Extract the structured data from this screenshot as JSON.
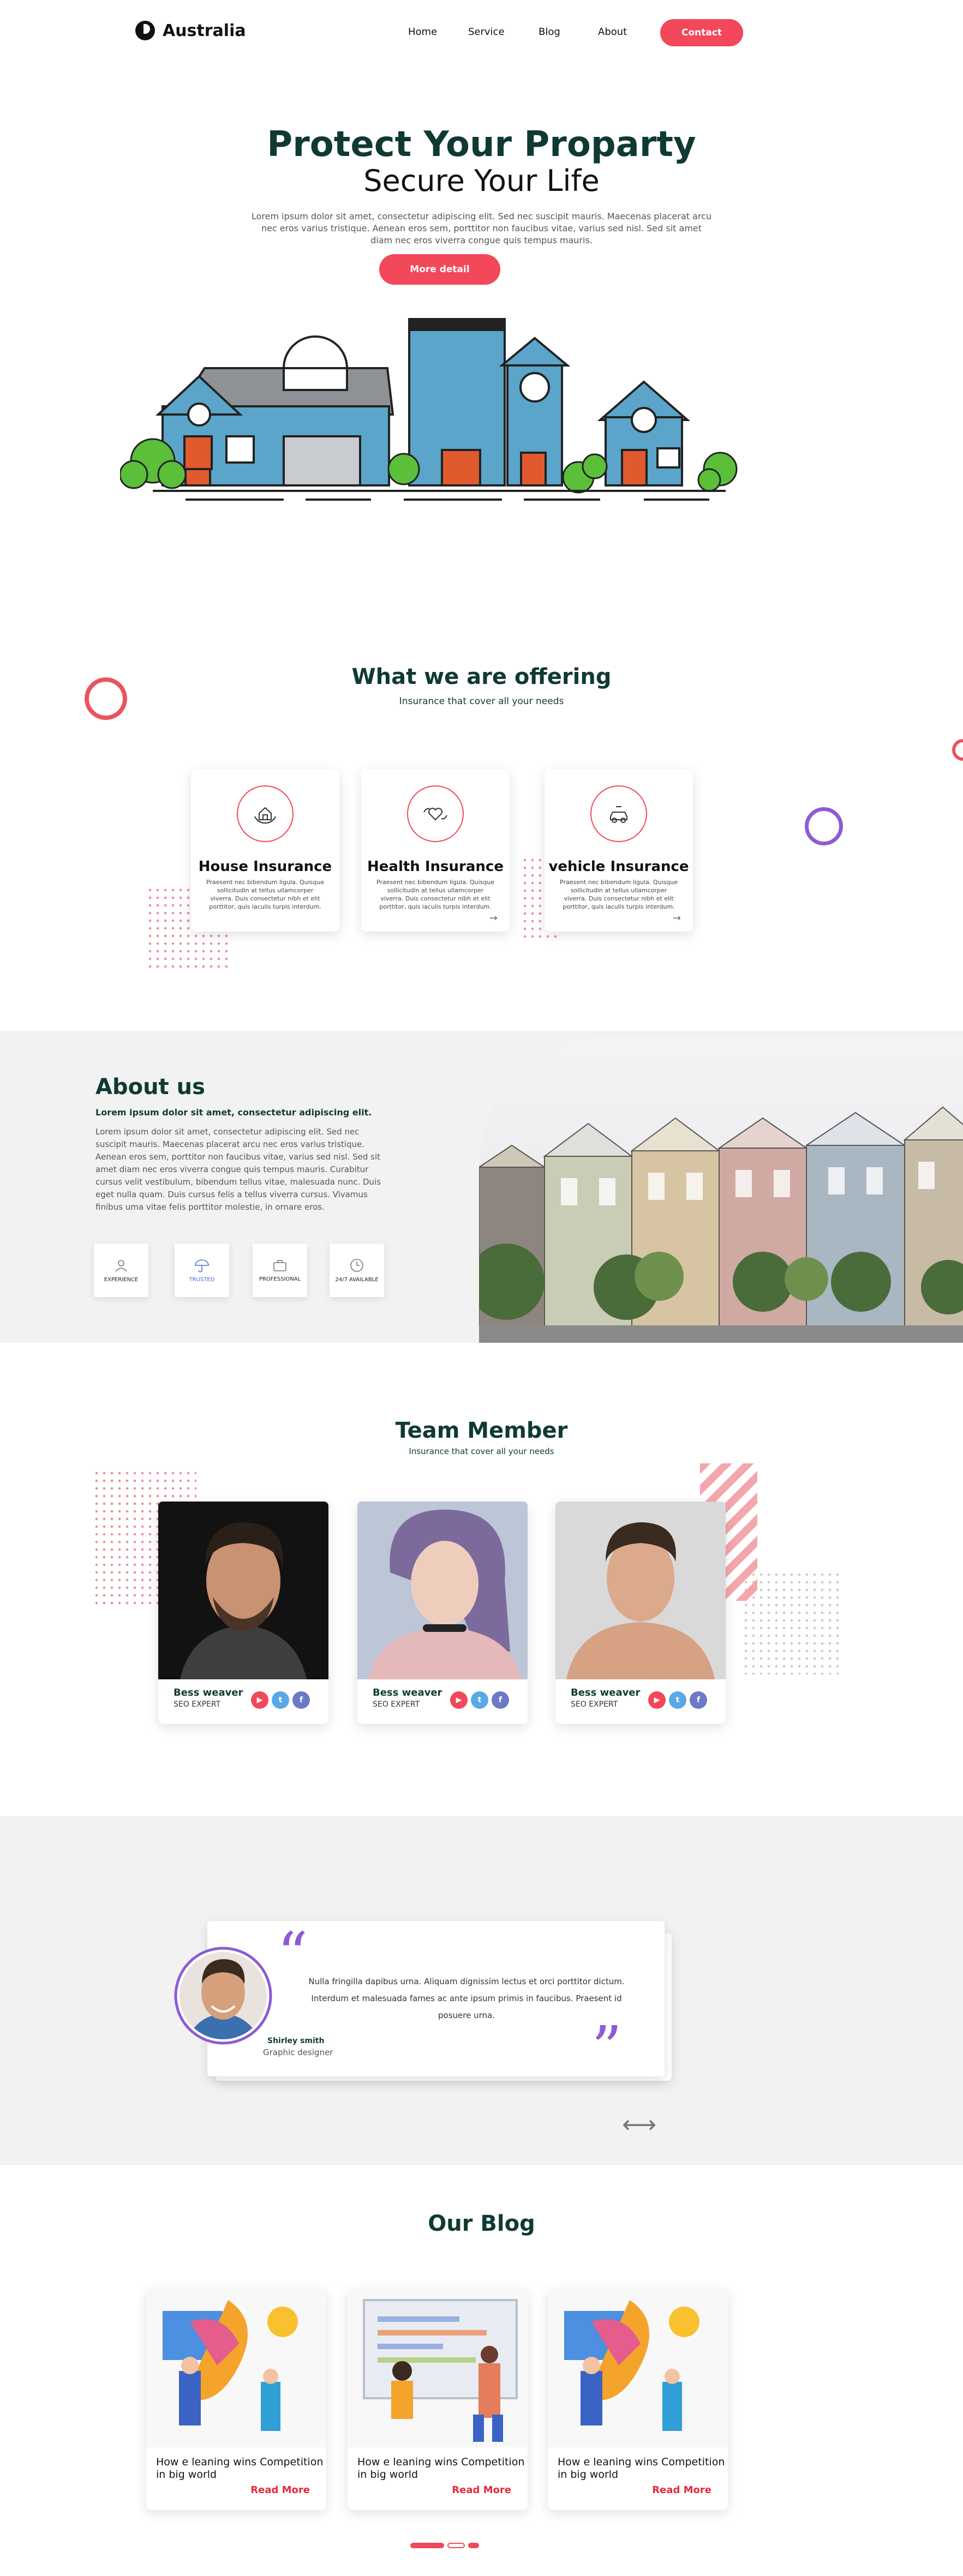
{
  "header": {
    "brand": "Australia",
    "nav": [
      "Home",
      "Service",
      "Blog",
      "About"
    ],
    "contact_label": "Contact"
  },
  "hero": {
    "title": "Protect Your Proparty",
    "subtitle": "Secure Your Life",
    "text": "Lorem ipsum dolor sit amet, consectetur adipiscing elit. Sed nec suscipit mauris. Maecenas placerat arcu nec eros varius tristique. Aenean eros sem, porttitor non faucibus vitae, varius sed nisl. Sed sit amet diam nec eros viverra congue quis tempus mauris.",
    "button": "More detail"
  },
  "offering": {
    "title": "What we are offering",
    "subtitle": "Insurance that cover all your needs",
    "cards": [
      {
        "title": "House Insurance",
        "text": "Praesent nec bibendum ligula. Quisque sollicitudin at tellus ullamcorper viverra. Duis consectetur nibh et elit porttitor, quis iaculis turpis interdum.",
        "arrow": "→",
        "icon": "house-hands-icon"
      },
      {
        "title": "Health Insurance",
        "text": "Praesent nec bibendum ligula. Quisque sollicitudin at tellus ullamcorper viverra. Duis consectetur nibh et elit porttitor, quis iaculis turpis interdum.",
        "arrow": "→",
        "icon": "heart-hands-icon"
      },
      {
        "title": "vehicle Insurance",
        "text": "Praesent nec bibendum ligula. Quisque sollicitudin at tellus ullamcorper viverra. Duis consectetur nibh et elit porttitor, quis iaculis turpis interdum.",
        "arrow": "→",
        "icon": "car-icon"
      }
    ]
  },
  "about": {
    "title": "About us",
    "lead": "Lorem ipsum dolor sit amet, consectetur adipiscing elit.",
    "text": "Lorem ipsum dolor sit amet, consectetur adipiscing elit. Sed nec suscipit mauris. Maecenas placerat arcu nec eros varius tristique. Aenean eros sem, porttitor non faucibus vitae, varius sed nisl. Sed sit amet diam nec eros viverra congue quis tempus mauris. Curabitur cursus velit vestibulum, bibendum tellus vitae, malesuada nunc. Duis eget nulla quam. Duis cursus felis a tellus viverra cursus. Vivamus finibus uma vitae felis porttitor molestie, in ornare eros.",
    "badges": [
      "EXPERIENCE",
      "TRUSTED",
      "PROFESSIONAL",
      "24/7 AVAILABLE"
    ]
  },
  "team": {
    "title": "Team Member",
    "subtitle": "Insurance that cover all your needs",
    "members": [
      {
        "name": "Bess weaver",
        "role": "SEO EXPERT"
      },
      {
        "name": "Bess weaver",
        "role": "SEO EXPERT"
      },
      {
        "name": "Bess weaver",
        "role": "SEO EXPERT"
      }
    ],
    "social": [
      "youtube-icon",
      "twitter-icon",
      "facebook-icon"
    ]
  },
  "testimonial": {
    "text": "Nulla fringilla dapibus urna. Aliquam dignissim lectus et orci porttitor dictum. Interdum et malesuada fames ac ante ipsum primis in faucibus. Praesent id posuere urna.",
    "name": "Shirley smith",
    "role": "Graphic designer",
    "arrows": "⟷"
  },
  "blog": {
    "title": "Our Blog",
    "posts": [
      {
        "title": "How e leaning wins Competition in big world",
        "more": "Read More"
      },
      {
        "title": "How e leaning wins Competition in big world",
        "more": "Read More"
      },
      {
        "title": "How e leaning wins Competition in big world",
        "more": "Read More"
      }
    ]
  },
  "colors": {
    "accent": "#f2485a",
    "dark": "#0f3a33",
    "purple": "#8c5bd6"
  }
}
